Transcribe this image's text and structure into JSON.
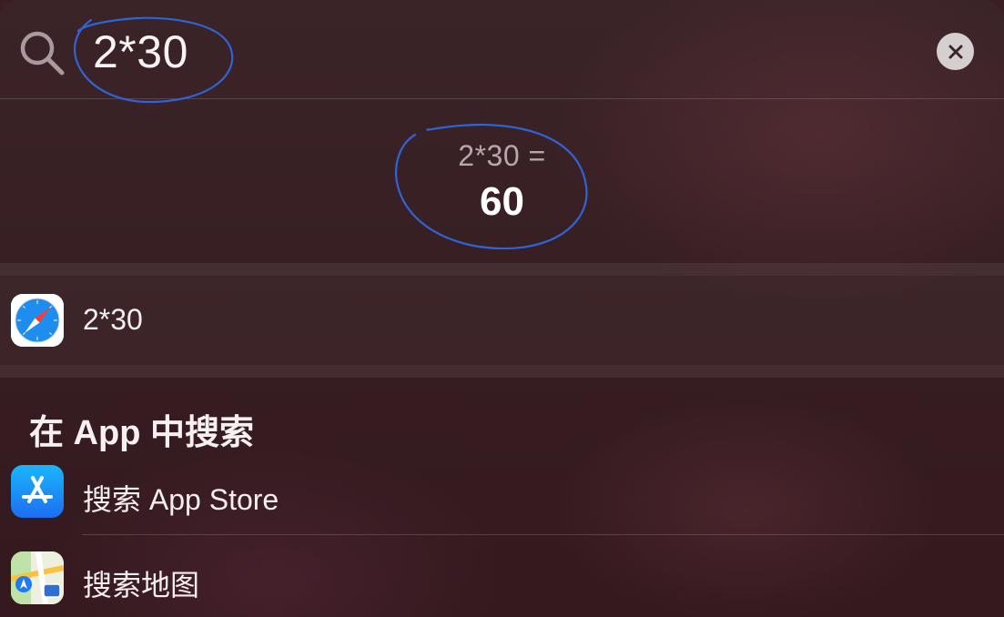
{
  "search": {
    "query": "2*30",
    "icons": {
      "search": "magnifier-icon",
      "clear": "close-circle-icon"
    }
  },
  "calculator": {
    "expression": "2*30 =",
    "result": "60"
  },
  "web_result": {
    "icon": "safari-icon",
    "label": "2*30"
  },
  "app_search": {
    "section_title": "在 App 中搜索",
    "items": [
      {
        "icon": "app-store-icon",
        "label": "搜索 App Store"
      },
      {
        "icon": "maps-icon",
        "label": "搜索地图"
      }
    ]
  },
  "colors": {
    "annotation": "#2f63d6",
    "background": "#3a1e22",
    "clear_button": "#d6cfd1"
  }
}
